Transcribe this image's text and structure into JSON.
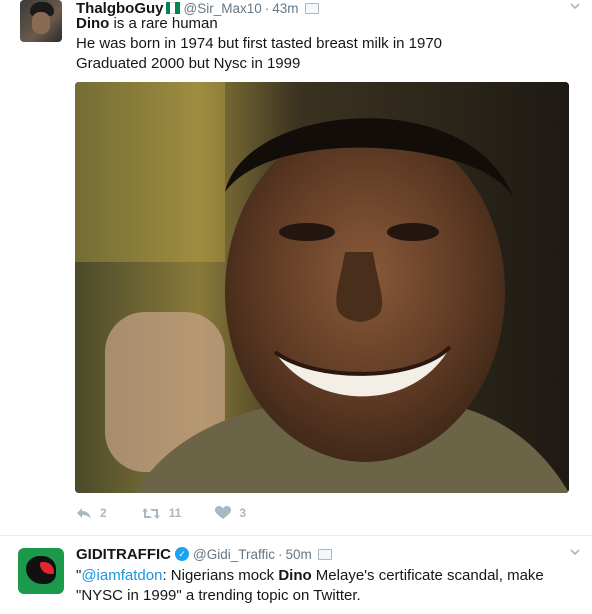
{
  "tweets": [
    {
      "display_name": "ThalgboGuy",
      "handle": "@Sir_Max10",
      "separator": "·",
      "time": "43m",
      "text": {
        "keyword": "Dino",
        "line1_rest": " is a rare human",
        "line2": "He was born in 1974 but first tasted breast milk in 1970",
        "line3": "Graduated 2000 but Nysc in 1999"
      },
      "flag_colors": [
        "#008751",
        "#ffffff",
        "#008751"
      ],
      "actions": {
        "reply_count": "2",
        "retweet_count": "11",
        "like_count": "3"
      }
    },
    {
      "display_name": "GIDITRAFFIC",
      "handle": "@Gidi_Traffic",
      "separator": "·",
      "time": "50m",
      "text": {
        "quote_open": "\"",
        "mention": "@iamfatdon",
        "part1": ": Nigerians mock ",
        "keyword": "Dino",
        "part2": " Melaye's certificate scandal, make \"NYSC in 1999\" a trending topic on Twitter."
      },
      "verified": true
    }
  ],
  "icons": {
    "reply": "reply-icon",
    "retweet": "retweet-icon",
    "like": "heart-icon",
    "menu": "chevron-down-icon",
    "dm": "message-icon"
  },
  "colors": {
    "link": "#1b95e0",
    "muted": "#657786",
    "icon": "#aab8c2",
    "verified": "#1da1f2"
  }
}
